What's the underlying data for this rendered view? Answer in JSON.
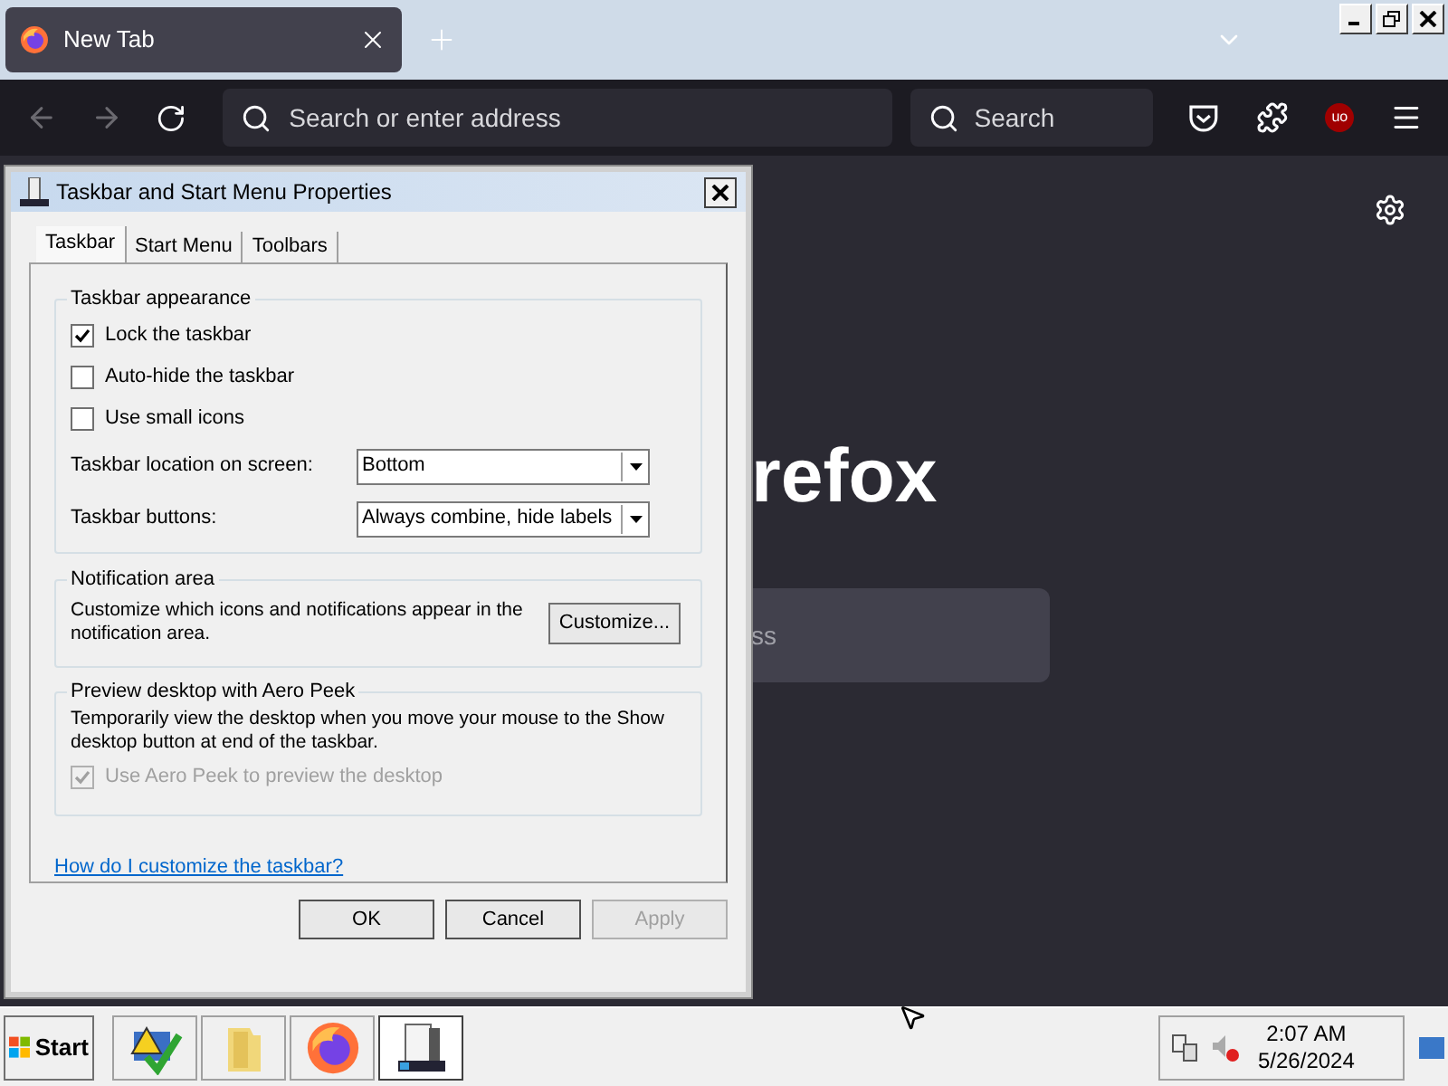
{
  "browser": {
    "tab": {
      "title": "New Tab",
      "selected": true
    },
    "address": {
      "placeholder": "Search or enter address"
    },
    "search": {
      "placeholder": "Search"
    },
    "extension_badge": "uo"
  },
  "newtab": {
    "logo_text": "refox",
    "search_hint": "ss"
  },
  "dialog": {
    "title": "Taskbar and Start Menu Properties",
    "tabs": [
      {
        "label": "Taskbar",
        "selected": true
      },
      {
        "label": "Start Menu",
        "selected": false
      },
      {
        "label": "Toolbars",
        "selected": false
      }
    ],
    "appearance": {
      "legend": "Taskbar appearance",
      "checkboxes": [
        {
          "label": "Lock the taskbar",
          "checked": true
        },
        {
          "label": "Auto-hide the taskbar",
          "checked": false
        },
        {
          "label": "Use small icons",
          "checked": false
        }
      ],
      "dropdowns": [
        {
          "label": "Taskbar location on screen:",
          "value": "Bottom"
        },
        {
          "label": "Taskbar buttons:",
          "value": "Always combine, hide labels"
        }
      ]
    },
    "notification": {
      "legend": "Notification area",
      "text": "Customize which icons and notifications appear in the notification area.",
      "button": "Customize..."
    },
    "peek": {
      "legend": "Preview desktop with Aero Peek",
      "text": "Temporarily view the desktop when you move your mouse to the Show desktop button at end of the taskbar.",
      "checkbox": {
        "label": "Use Aero Peek to preview the desktop",
        "checked": true,
        "disabled": true
      }
    },
    "link": "How do I customize the taskbar?",
    "buttons": [
      {
        "label": "OK",
        "disabled": false
      },
      {
        "label": "Cancel",
        "disabled": false
      },
      {
        "label": "Apply",
        "disabled": true
      }
    ]
  },
  "taskbar": {
    "start": "Start",
    "apps": [
      {
        "kind": "security",
        "selected": false
      },
      {
        "kind": "folder",
        "selected": false
      },
      {
        "kind": "browser",
        "selected": false
      },
      {
        "kind": "properties",
        "selected": true
      }
    ],
    "time": "2:07 AM",
    "date": "5/26/2024"
  }
}
